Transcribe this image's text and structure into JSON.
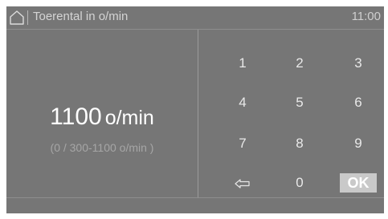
{
  "header": {
    "title": "Toerental in o/min",
    "clock": "11:00",
    "home_icon": "home-icon"
  },
  "display": {
    "value": "1100",
    "unit": "o/min",
    "range": "(0 / 300-1100 o/min )"
  },
  "keypad": {
    "keys": [
      "1",
      "2",
      "3",
      "4",
      "5",
      "6",
      "7",
      "8",
      "9"
    ],
    "backspace_icon": "backspace-arrow-icon",
    "zero": "0",
    "ok": "OK"
  },
  "colors": {
    "screen_bg": "#767676",
    "ok_bg": "#c9c9c9",
    "text_primary": "#ffffff",
    "text_secondary": "#a6a6a6"
  }
}
